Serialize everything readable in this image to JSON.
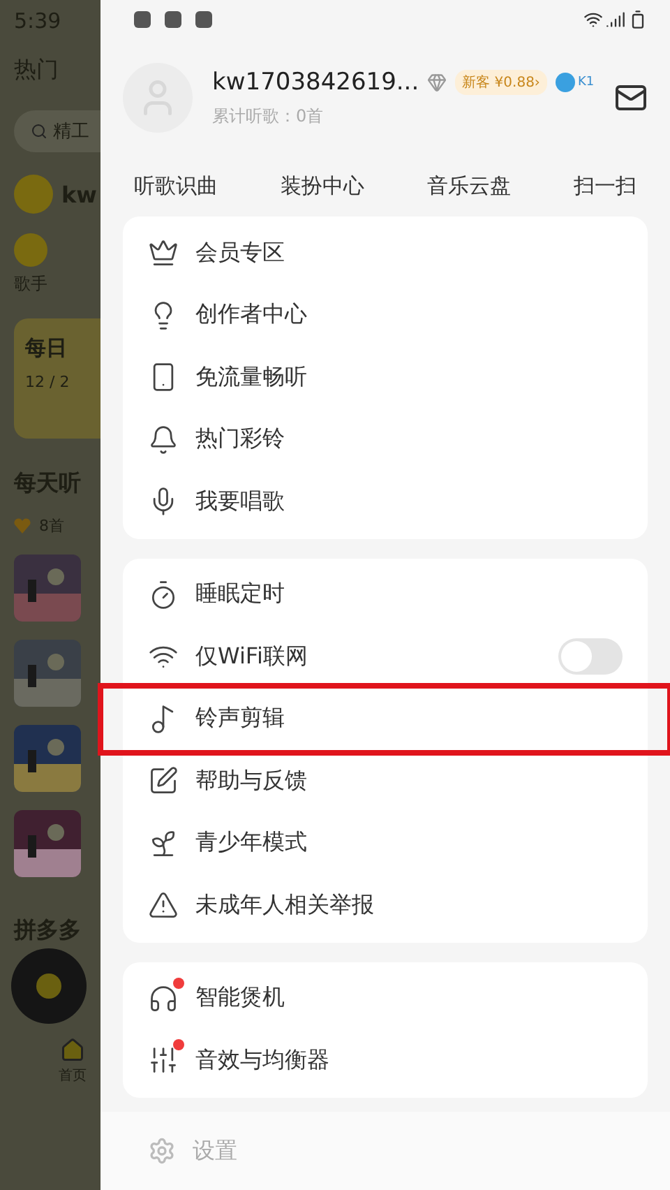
{
  "background_page": {
    "time": "5:39",
    "tab": "热门",
    "search_placeholder": "精工",
    "user": "kw",
    "category": "歌手",
    "daily_card": {
      "title": "每日",
      "date": "12 / 2"
    },
    "section_title": "每天听",
    "count": "8首",
    "section_title_2": "拼多多",
    "nav_label": "首页"
  },
  "drawer": {
    "profile": {
      "username": "kw1703842619...",
      "promo_badge": "新客 ¥0.88›",
      "level_badge": "K1",
      "subtitle": "累计听歌：0首"
    },
    "quick_links": [
      "听歌识曲",
      "装扮中心",
      "音乐云盘",
      "扫一扫"
    ],
    "sections": [
      {
        "items": [
          {
            "label": "会员专区"
          },
          {
            "label": "创作者中心"
          },
          {
            "label": "免流量畅听"
          },
          {
            "label": "热门彩铃"
          },
          {
            "label": "我要唱歌"
          }
        ]
      },
      {
        "items": [
          {
            "label": "睡眠定时"
          },
          {
            "label": "仅WiFi联网",
            "kind": "toggle",
            "on": false
          },
          {
            "label": "铃声剪辑",
            "highlighted": true
          },
          {
            "label": "帮助与反馈"
          },
          {
            "label": "青少年模式"
          },
          {
            "label": "未成年人相关举报"
          }
        ]
      },
      {
        "items": [
          {
            "label": "智能煲机",
            "new_dot": true
          },
          {
            "label": "音效与均衡器",
            "new_dot": true
          }
        ]
      }
    ],
    "footer": {
      "label": "设置",
      "disabled": true
    }
  }
}
